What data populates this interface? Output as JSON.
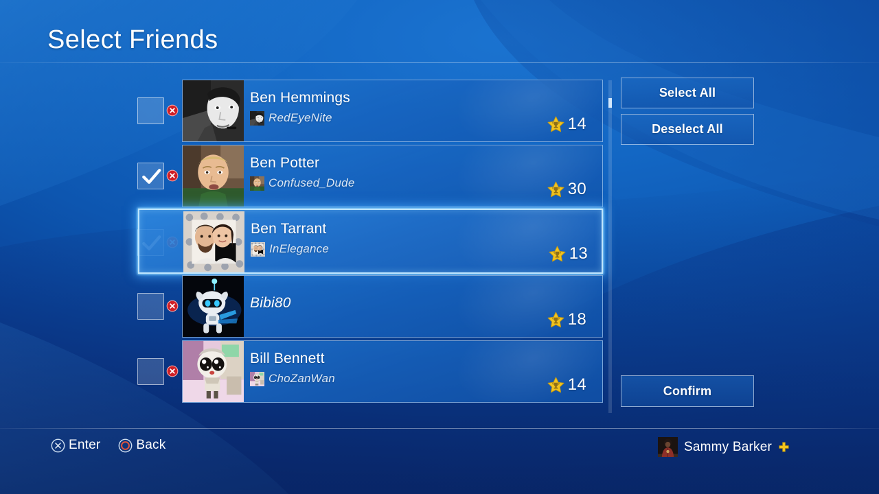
{
  "header": {
    "title": "Select Friends"
  },
  "friends": [
    {
      "real_name": "Ben Hemmings",
      "online_id": "RedEyeNite",
      "level": "14",
      "checked": false,
      "focused": false,
      "name_is_id_only": false
    },
    {
      "real_name": "Ben Potter",
      "online_id": "Confused_Dude",
      "level": "30",
      "checked": true,
      "focused": false,
      "name_is_id_only": false
    },
    {
      "real_name": "Ben Tarrant",
      "online_id": "InElegance",
      "level": "13",
      "checked": true,
      "focused": true,
      "name_is_id_only": false
    },
    {
      "real_name": "",
      "online_id": "Bibi80",
      "level": "18",
      "checked": false,
      "focused": false,
      "name_is_id_only": true
    },
    {
      "real_name": "Bill Bennett",
      "online_id": "ChoZanWan",
      "level": "14",
      "checked": false,
      "focused": false,
      "name_is_id_only": false
    }
  ],
  "buttons": {
    "select_all": "Select All",
    "deselect_all": "Deselect All",
    "confirm": "Confirm"
  },
  "footer": {
    "enter_label": "Enter",
    "back_label": "Back",
    "user_name": "Sammy Barker"
  },
  "icons": {
    "cross_button": "cross-button-icon",
    "circle_button": "circle-button-icon",
    "ps_plus": "ps-plus-icon",
    "star": "trophy-star-icon",
    "remove": "remove-friend-x-icon",
    "check": "checkmark-icon"
  },
  "colors": {
    "background_blue": "#0d56b0",
    "accent_highlight": "#bfe6ff",
    "star_gold": "#f5c518",
    "remove_red": "#d22027",
    "ps_plus_gold": "#f0c419"
  }
}
